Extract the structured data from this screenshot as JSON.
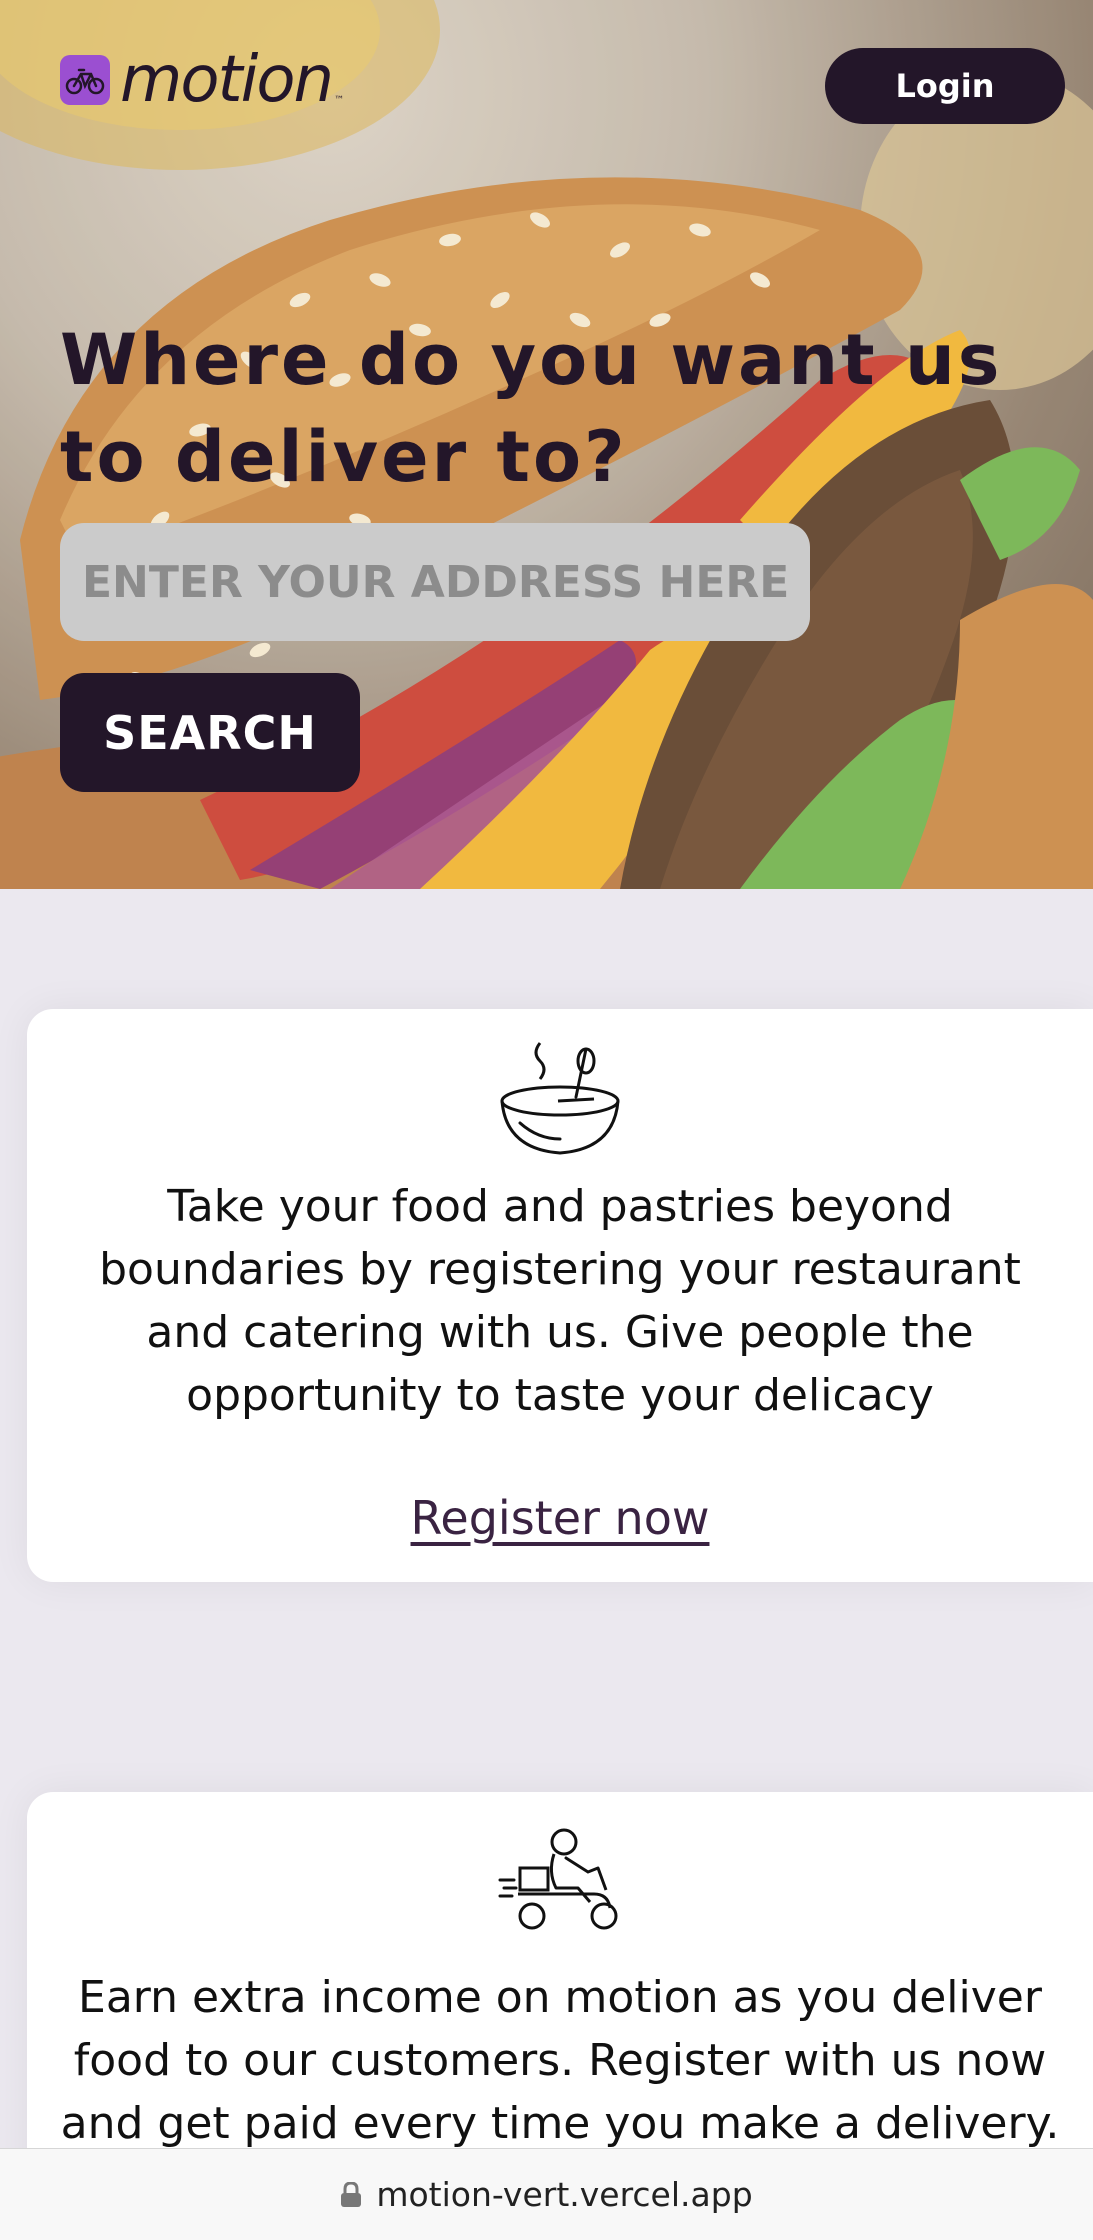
{
  "brand": {
    "name": "motion",
    "tm": "™"
  },
  "header": {
    "login_label": "Login"
  },
  "hero": {
    "headline": "Where do you want us to deliver to?",
    "address_placeholder": "ENTER YOUR ADDRESS HERE",
    "search_label": "SEARCH"
  },
  "cards": [
    {
      "icon": "soup-bowl-icon",
      "text": "Take your food and pastries beyond boundaries by registering your restaurant and catering with us. Give people the opportunity to taste your delicacy",
      "link_label": "Register now"
    },
    {
      "icon": "delivery-scooter-icon",
      "text": "Earn extra income on motion as you deliver food to our customers. Register with us now and get paid every time you make a delivery."
    }
  ],
  "browser": {
    "url": "motion-vert.vercel.app"
  },
  "colors": {
    "primary_dark": "#231629",
    "logo_accent": "#9b4fd1",
    "page_bg": "#ebe8ef"
  }
}
